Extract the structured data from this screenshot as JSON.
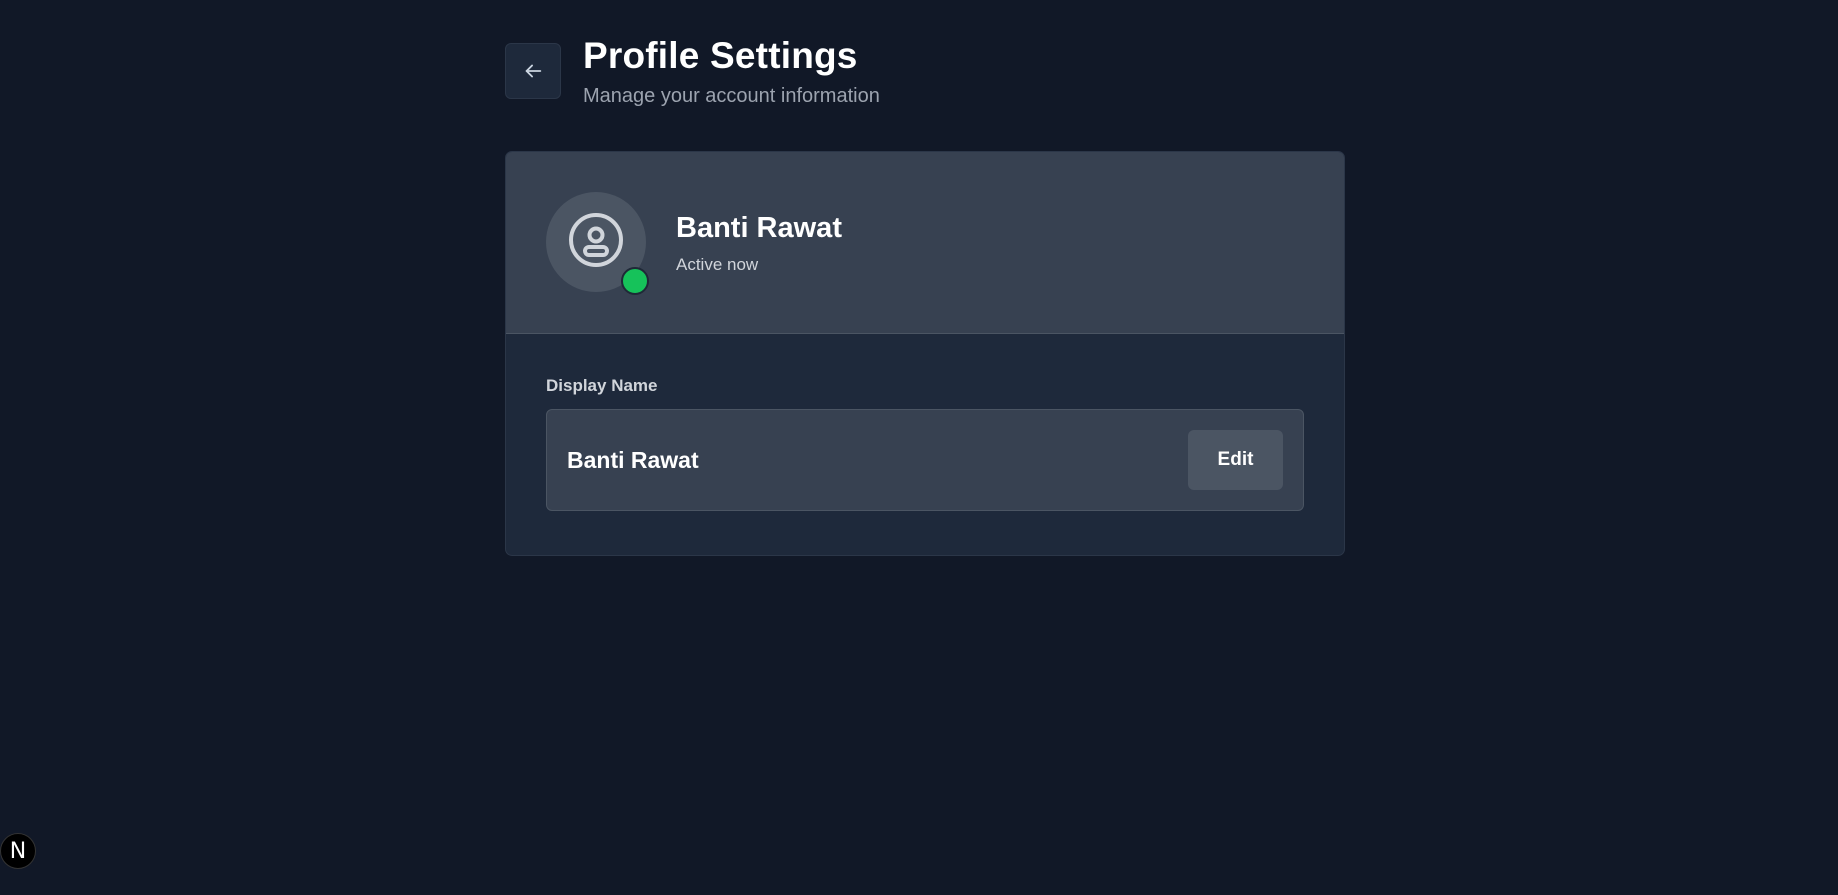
{
  "header": {
    "title": "Profile Settings",
    "subtitle": "Manage your account information",
    "back_icon": "arrow-left-icon"
  },
  "profile": {
    "name": "Banti Rawat",
    "status": "Active now",
    "avatar_icon": "user-circle-icon",
    "status_color": "#16c25a"
  },
  "display_name": {
    "label": "Display Name",
    "value": "Banti Rawat",
    "edit_label": "Edit"
  },
  "dev_badge": {
    "label": "N"
  },
  "colors": {
    "background": "#111827",
    "card": "#1e293b",
    "card_header": "#374151",
    "button": "#4b5563",
    "muted_text": "#9ca3af"
  }
}
